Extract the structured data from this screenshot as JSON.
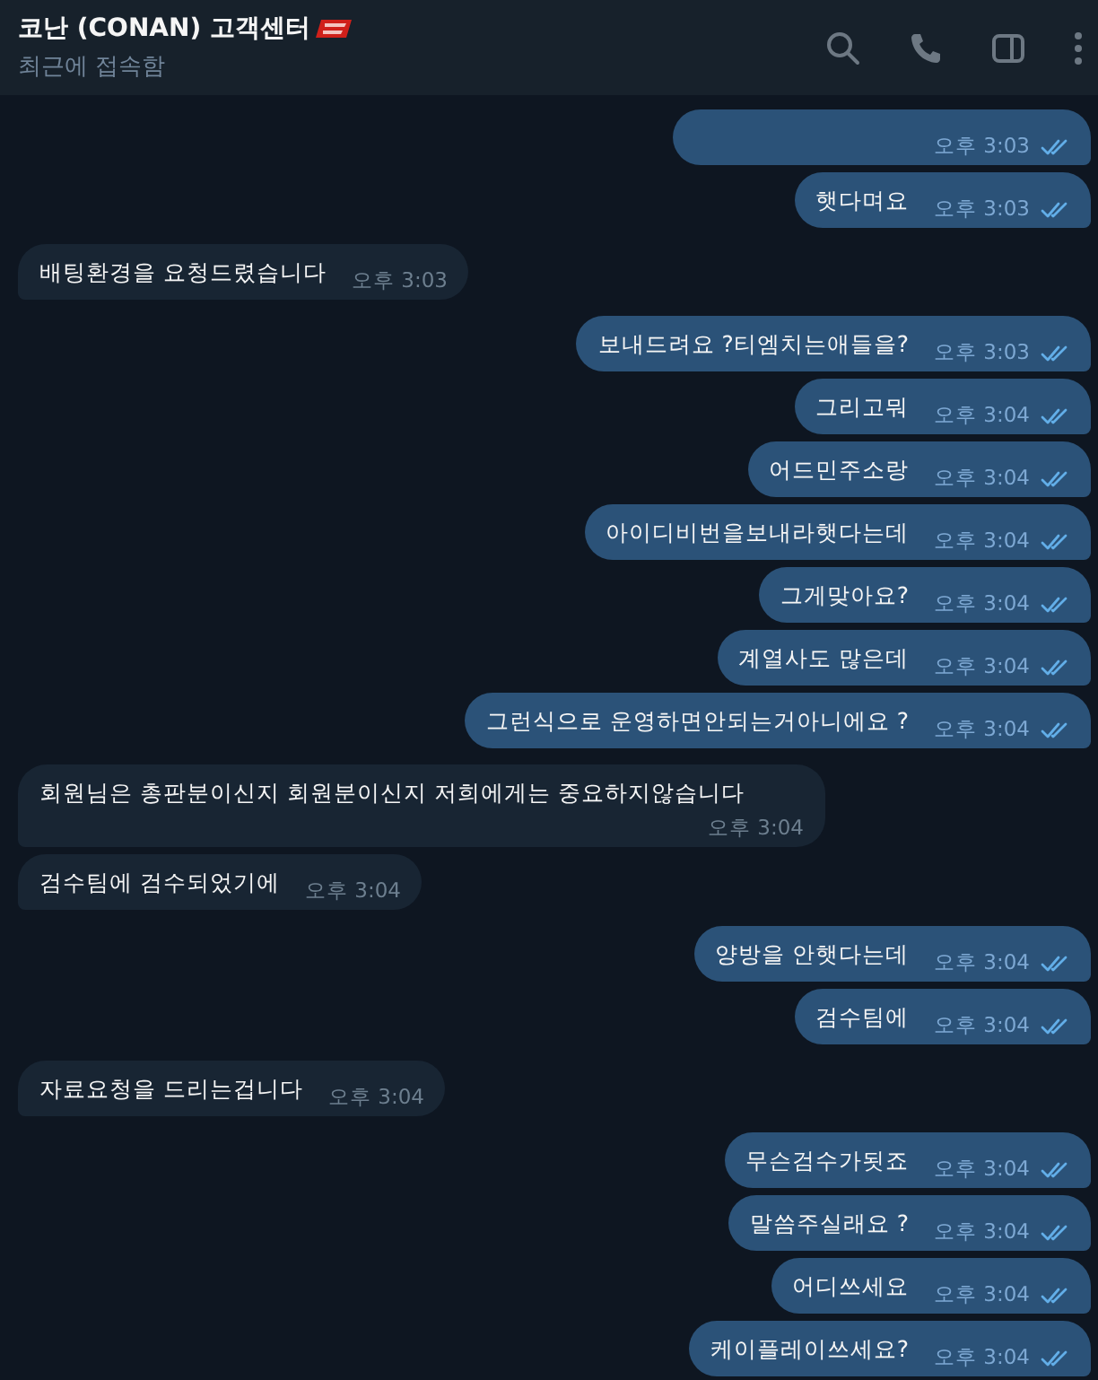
{
  "header": {
    "title": "코난 (CONAN) 고객센터",
    "status": "최근에 접속함"
  },
  "messages": [
    {
      "kind": "outgoing",
      "time": "오후 3:03",
      "read": true
    },
    {
      "kind": "outgoing",
      "text": "햇다며요",
      "time": "오후 3:03",
      "read": true
    },
    {
      "kind": "incoming",
      "text": "배팅환경을 요청드렸습니다",
      "time": "오후 3:03"
    },
    {
      "kind": "outgoing",
      "text": "보내드려요 ?티엠치는애들을?",
      "time": "오후 3:03",
      "read": true
    },
    {
      "kind": "outgoing",
      "text": "그리고뭐",
      "time": "오후 3:04",
      "read": true
    },
    {
      "kind": "outgoing",
      "text": "어드민주소랑",
      "time": "오후 3:04",
      "read": true
    },
    {
      "kind": "outgoing",
      "text": "아이디비번을보내라햇다는데",
      "time": "오후 3:04",
      "read": true
    },
    {
      "kind": "outgoing",
      "text": "그게맞아요?",
      "time": "오후 3:04",
      "read": true
    },
    {
      "kind": "outgoing",
      "text": "계열사도 많은데",
      "time": "오후 3:04",
      "read": true
    },
    {
      "kind": "outgoing",
      "text": "그런식으로 운영하면안되는거아니에요 ?",
      "time": "오후 3:04",
      "read": true
    },
    {
      "kind": "incoming",
      "text": "회원님은 총판분이신지 회원분이신지 저희에게는 중요하지않습니다",
      "time": "오후 3:04"
    },
    {
      "kind": "incoming",
      "text": "검수팀에 검수되었기에",
      "time": "오후 3:04"
    },
    {
      "kind": "outgoing",
      "text": "양방을 안햇다는데",
      "time": "오후 3:04",
      "read": true
    },
    {
      "kind": "outgoing",
      "text": "검수팀에",
      "time": "오후 3:04",
      "read": true
    },
    {
      "kind": "incoming",
      "text": "자료요청을 드리는겁니다",
      "time": "오후 3:04"
    },
    {
      "kind": "outgoing",
      "text": "무슨검수가됫죠",
      "time": "오후 3:04",
      "read": true
    },
    {
      "kind": "outgoing",
      "text": "말씀주실래요 ?",
      "time": "오후 3:04",
      "read": true
    },
    {
      "kind": "outgoing",
      "text": "어디쓰세요",
      "time": "오후 3:04",
      "read": true
    },
    {
      "kind": "outgoing",
      "text": "케이플레이쓰세요?",
      "time": "오후 3:04",
      "read": true
    }
  ]
}
